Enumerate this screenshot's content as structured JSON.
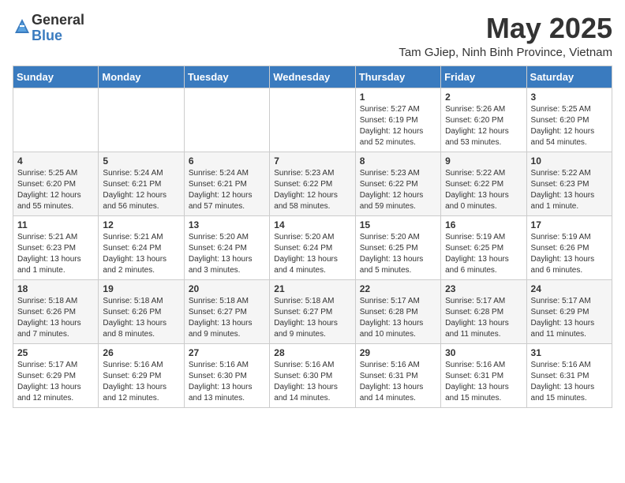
{
  "header": {
    "logo_general": "General",
    "logo_blue": "Blue",
    "month_title": "May 2025",
    "subtitle": "Tam GJiep, Ninh Binh Province, Vietnam"
  },
  "days_of_week": [
    "Sunday",
    "Monday",
    "Tuesday",
    "Wednesday",
    "Thursday",
    "Friday",
    "Saturday"
  ],
  "weeks": [
    [
      {
        "day": "",
        "info": ""
      },
      {
        "day": "",
        "info": ""
      },
      {
        "day": "",
        "info": ""
      },
      {
        "day": "",
        "info": ""
      },
      {
        "day": "1",
        "info": "Sunrise: 5:27 AM\nSunset: 6:19 PM\nDaylight: 12 hours\nand 52 minutes."
      },
      {
        "day": "2",
        "info": "Sunrise: 5:26 AM\nSunset: 6:20 PM\nDaylight: 12 hours\nand 53 minutes."
      },
      {
        "day": "3",
        "info": "Sunrise: 5:25 AM\nSunset: 6:20 PM\nDaylight: 12 hours\nand 54 minutes."
      }
    ],
    [
      {
        "day": "4",
        "info": "Sunrise: 5:25 AM\nSunset: 6:20 PM\nDaylight: 12 hours\nand 55 minutes."
      },
      {
        "day": "5",
        "info": "Sunrise: 5:24 AM\nSunset: 6:21 PM\nDaylight: 12 hours\nand 56 minutes."
      },
      {
        "day": "6",
        "info": "Sunrise: 5:24 AM\nSunset: 6:21 PM\nDaylight: 12 hours\nand 57 minutes."
      },
      {
        "day": "7",
        "info": "Sunrise: 5:23 AM\nSunset: 6:22 PM\nDaylight: 12 hours\nand 58 minutes."
      },
      {
        "day": "8",
        "info": "Sunrise: 5:23 AM\nSunset: 6:22 PM\nDaylight: 12 hours\nand 59 minutes."
      },
      {
        "day": "9",
        "info": "Sunrise: 5:22 AM\nSunset: 6:22 PM\nDaylight: 13 hours\nand 0 minutes."
      },
      {
        "day": "10",
        "info": "Sunrise: 5:22 AM\nSunset: 6:23 PM\nDaylight: 13 hours\nand 1 minute."
      }
    ],
    [
      {
        "day": "11",
        "info": "Sunrise: 5:21 AM\nSunset: 6:23 PM\nDaylight: 13 hours\nand 1 minute."
      },
      {
        "day": "12",
        "info": "Sunrise: 5:21 AM\nSunset: 6:24 PM\nDaylight: 13 hours\nand 2 minutes."
      },
      {
        "day": "13",
        "info": "Sunrise: 5:20 AM\nSunset: 6:24 PM\nDaylight: 13 hours\nand 3 minutes."
      },
      {
        "day": "14",
        "info": "Sunrise: 5:20 AM\nSunset: 6:24 PM\nDaylight: 13 hours\nand 4 minutes."
      },
      {
        "day": "15",
        "info": "Sunrise: 5:20 AM\nSunset: 6:25 PM\nDaylight: 13 hours\nand 5 minutes."
      },
      {
        "day": "16",
        "info": "Sunrise: 5:19 AM\nSunset: 6:25 PM\nDaylight: 13 hours\nand 6 minutes."
      },
      {
        "day": "17",
        "info": "Sunrise: 5:19 AM\nSunset: 6:26 PM\nDaylight: 13 hours\nand 6 minutes."
      }
    ],
    [
      {
        "day": "18",
        "info": "Sunrise: 5:18 AM\nSunset: 6:26 PM\nDaylight: 13 hours\nand 7 minutes."
      },
      {
        "day": "19",
        "info": "Sunrise: 5:18 AM\nSunset: 6:26 PM\nDaylight: 13 hours\nand 8 minutes."
      },
      {
        "day": "20",
        "info": "Sunrise: 5:18 AM\nSunset: 6:27 PM\nDaylight: 13 hours\nand 9 minutes."
      },
      {
        "day": "21",
        "info": "Sunrise: 5:18 AM\nSunset: 6:27 PM\nDaylight: 13 hours\nand 9 minutes."
      },
      {
        "day": "22",
        "info": "Sunrise: 5:17 AM\nSunset: 6:28 PM\nDaylight: 13 hours\nand 10 minutes."
      },
      {
        "day": "23",
        "info": "Sunrise: 5:17 AM\nSunset: 6:28 PM\nDaylight: 13 hours\nand 11 minutes."
      },
      {
        "day": "24",
        "info": "Sunrise: 5:17 AM\nSunset: 6:29 PM\nDaylight: 13 hours\nand 11 minutes."
      }
    ],
    [
      {
        "day": "25",
        "info": "Sunrise: 5:17 AM\nSunset: 6:29 PM\nDaylight: 13 hours\nand 12 minutes."
      },
      {
        "day": "26",
        "info": "Sunrise: 5:16 AM\nSunset: 6:29 PM\nDaylight: 13 hours\nand 12 minutes."
      },
      {
        "day": "27",
        "info": "Sunrise: 5:16 AM\nSunset: 6:30 PM\nDaylight: 13 hours\nand 13 minutes."
      },
      {
        "day": "28",
        "info": "Sunrise: 5:16 AM\nSunset: 6:30 PM\nDaylight: 13 hours\nand 14 minutes."
      },
      {
        "day": "29",
        "info": "Sunrise: 5:16 AM\nSunset: 6:31 PM\nDaylight: 13 hours\nand 14 minutes."
      },
      {
        "day": "30",
        "info": "Sunrise: 5:16 AM\nSunset: 6:31 PM\nDaylight: 13 hours\nand 15 minutes."
      },
      {
        "day": "31",
        "info": "Sunrise: 5:16 AM\nSunset: 6:31 PM\nDaylight: 13 hours\nand 15 minutes."
      }
    ]
  ]
}
